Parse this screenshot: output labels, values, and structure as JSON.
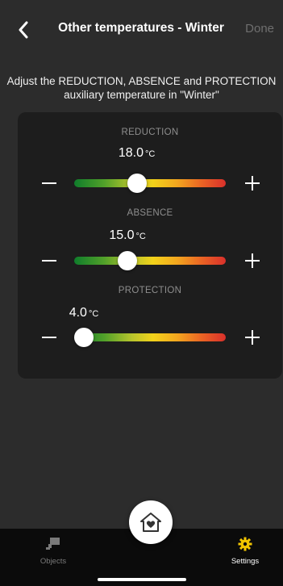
{
  "header": {
    "title": "Other temperatures - Winter",
    "done_label": "Done"
  },
  "subtitle": {
    "line1": "Adjust the REDUCTION, ABSENCE and PROTECTION",
    "line2": "auxiliary temperature in \"Winter\""
  },
  "sliders": [
    {
      "label": "REDUCTION",
      "value": "18.0",
      "unit": "°C",
      "level": 0.4
    },
    {
      "label": "ABSENCE",
      "value": "15.0",
      "unit": "°C",
      "level": 0.33
    },
    {
      "label": "PROTECTION",
      "value": "4.0",
      "unit": "°C",
      "level": 0.0
    }
  ],
  "tabbar": {
    "objects_label": "Objects",
    "settings_label": "Settings",
    "objects_icon": "objects-icon",
    "settings_icon": "gear-icon",
    "home_icon": "home-heart-icon"
  },
  "colors": {
    "background": "#2c2c2c",
    "card": "#1d1d1d",
    "tabbar": "#0b0b0b",
    "accent_active": "#f2c500",
    "inactive": "#7a7a7a",
    "done_disabled": "#6f6f6f"
  }
}
